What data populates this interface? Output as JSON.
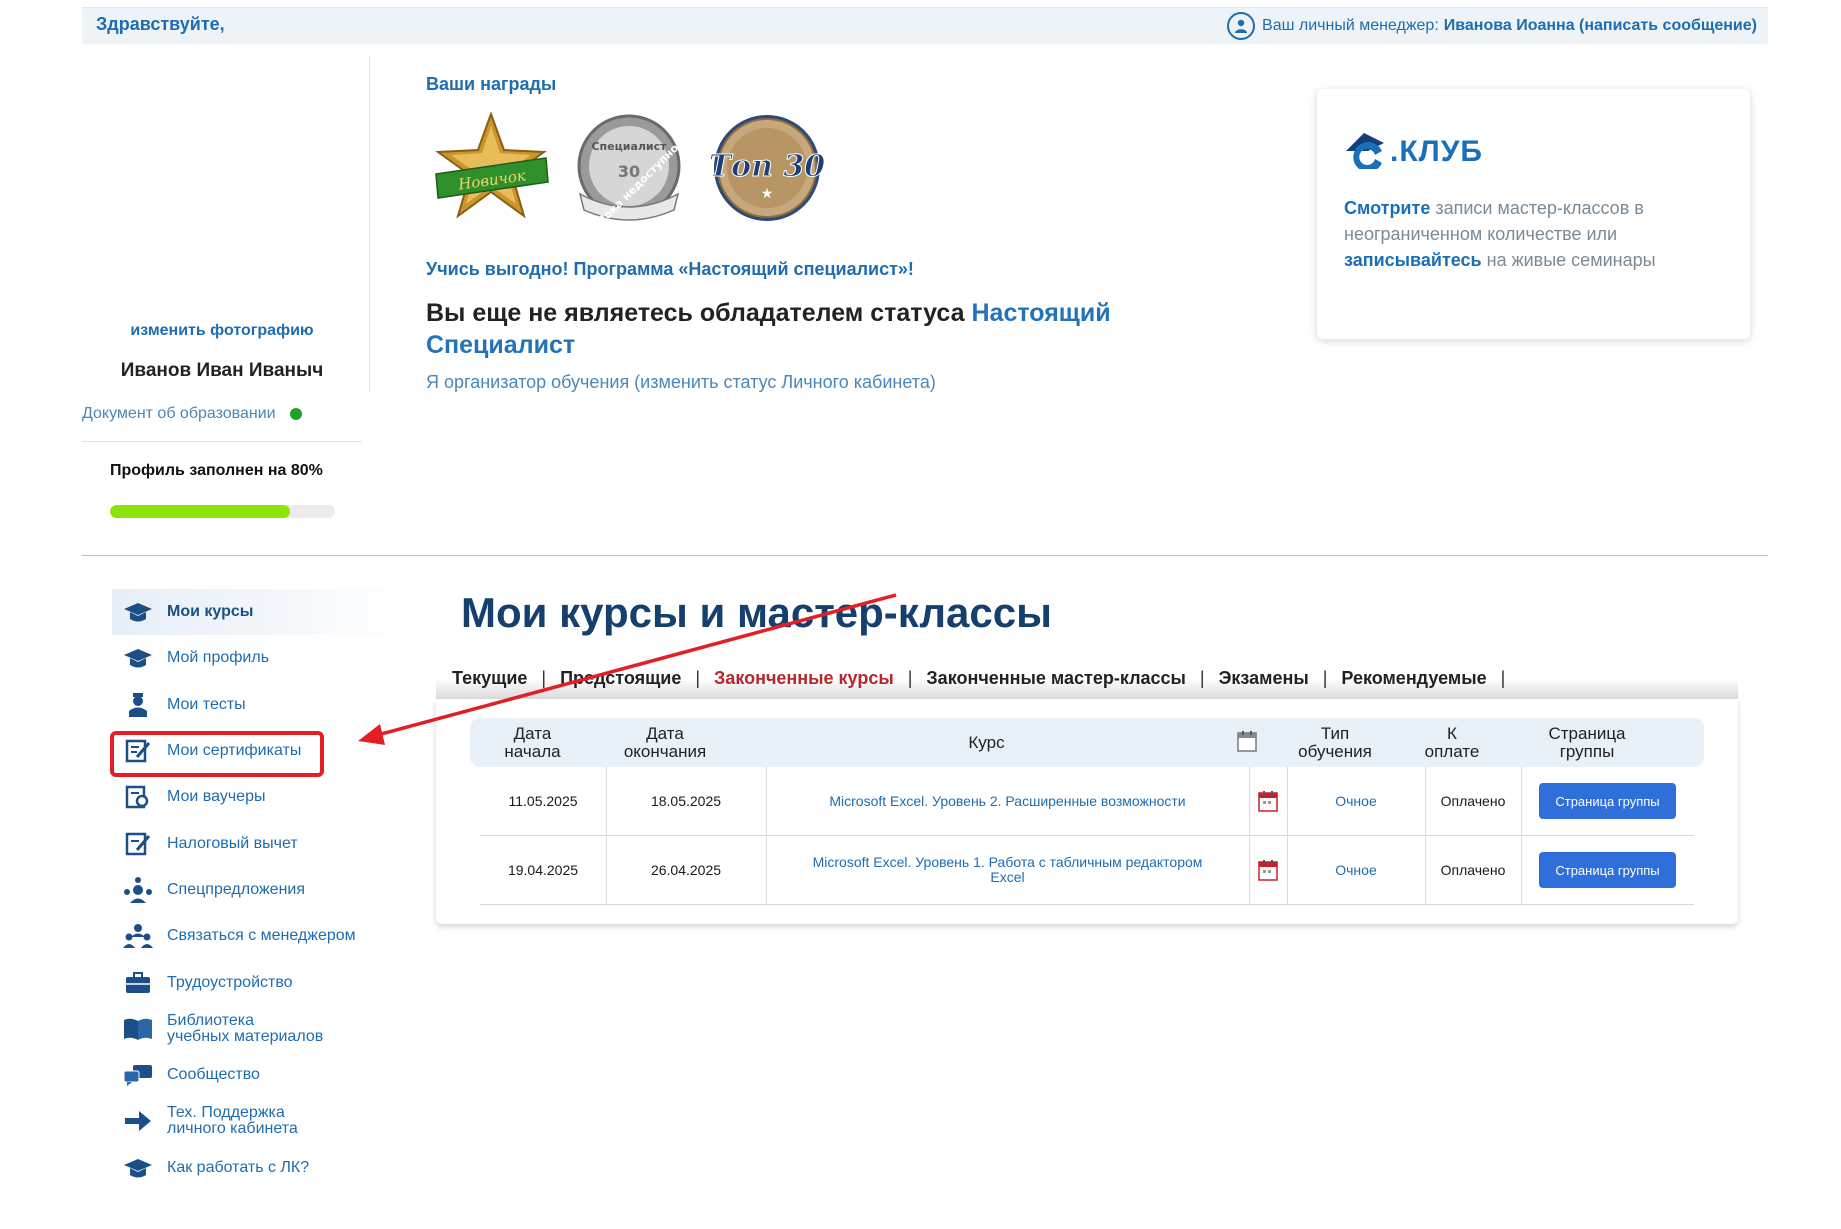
{
  "header": {
    "greeting": "Здравствуйте,",
    "manager_label": "Ваш личный менеджер:",
    "manager_name": "Иванова Иоанна (написать сообщение)"
  },
  "profile": {
    "change_photo": "изменить фотографию",
    "user_name": "Иванов Иван Иваныч",
    "education_doc": "Документ об образовании",
    "fill_text": "Профиль заполнен на 80%",
    "fill_percent": 80
  },
  "awards": {
    "title": "Ваши награды",
    "badges": [
      {
        "icon": "star-badge-icon",
        "label": "Новичок"
      },
      {
        "icon": "specialist-badge-icon",
        "label": "Специалист",
        "sub": "Пока недоступно"
      },
      {
        "icon": "top30-badge-icon",
        "label": "Топ 30"
      }
    ]
  },
  "program": {
    "promo": "Учись выгодно! Программа «Настоящий специалист»!",
    "status_prefix": "Вы еще не являетесь обладателем статуса ",
    "status_link": "Настоящий Специалист",
    "organizer": "Я организатор обучения (изменить статус Личного кабинета)"
  },
  "club": {
    "name": ".КЛУБ",
    "link1": "Смотрите",
    "text1": " записи мастер-классов в неограниченном количестве или ",
    "link2": "записывайтесь",
    "text2": " на живые семинары"
  },
  "menu": {
    "items": [
      {
        "label": "Мои курсы",
        "icon": "graduation-cap-icon",
        "active": true
      },
      {
        "label": "Мой профиль",
        "icon": "graduation-cap-icon"
      },
      {
        "label": "Мои тесты",
        "icon": "student-icon"
      },
      {
        "label": "Мои сертификаты",
        "icon": "certificate-icon",
        "highlighted": true
      },
      {
        "label": "Мои ваучеры",
        "icon": "voucher-icon"
      },
      {
        "label": "Налоговый вычет",
        "icon": "tax-icon"
      },
      {
        "label": "Спецпредложения",
        "icon": "offers-icon"
      },
      {
        "label": "Связаться с менеджером",
        "icon": "people-icon"
      },
      {
        "label": "Трудоустройство",
        "icon": "briefcase-icon"
      },
      {
        "label": "Библиотека",
        "label2": "учебных материалов",
        "icon": "book-icon"
      },
      {
        "label": "Сообщество",
        "icon": "chat-icon"
      },
      {
        "label": "Тех. Поддержка",
        "label2": "личного кабинета",
        "icon": "arrow-right-icon"
      },
      {
        "label": "Как работать с ЛК?",
        "icon": "graduation-cap-icon"
      }
    ]
  },
  "courses": {
    "title": "Мои курсы и мастер-классы",
    "tabs": [
      {
        "label": "Текущие"
      },
      {
        "label": "Предстоящие"
      },
      {
        "label": "Законченные курсы",
        "active": true
      },
      {
        "label": "Законченные мастер-классы"
      },
      {
        "label": "Экзамены"
      },
      {
        "label": "Рекомендуемые"
      }
    ],
    "columns": {
      "start1": "Дата",
      "start2": "начала",
      "end1": "Дата",
      "end2": "окончания",
      "course": "Курс",
      "type1": "Тип",
      "type2": "обучения",
      "pay1": "К",
      "pay2": "оплате",
      "group1": "Страница",
      "group2": "группы"
    },
    "rows": [
      {
        "start": "11.05.2025",
        "end": "18.05.2025",
        "course": "Microsoft Excel. Уровень 2. Расширенные возможности",
        "course2": "",
        "type": "Очное",
        "payment": "Оплачено",
        "button": "Страница группы"
      },
      {
        "start": "19.04.2025",
        "end": "26.04.2025",
        "course": "Microsoft Excel. Уровень 1. Работа с табличным редактором",
        "course2": "Excel",
        "type": "Очное",
        "payment": "Оплачено",
        "button": "Страница группы"
      }
    ]
  },
  "colors": {
    "brand_blue": "#1f6cb0",
    "title_navy": "#15406d",
    "active_tab": "#b5282e",
    "highlight_red": "#e31e24",
    "progress_green": "#8ee30b",
    "button_blue": "#2f6fd9"
  }
}
